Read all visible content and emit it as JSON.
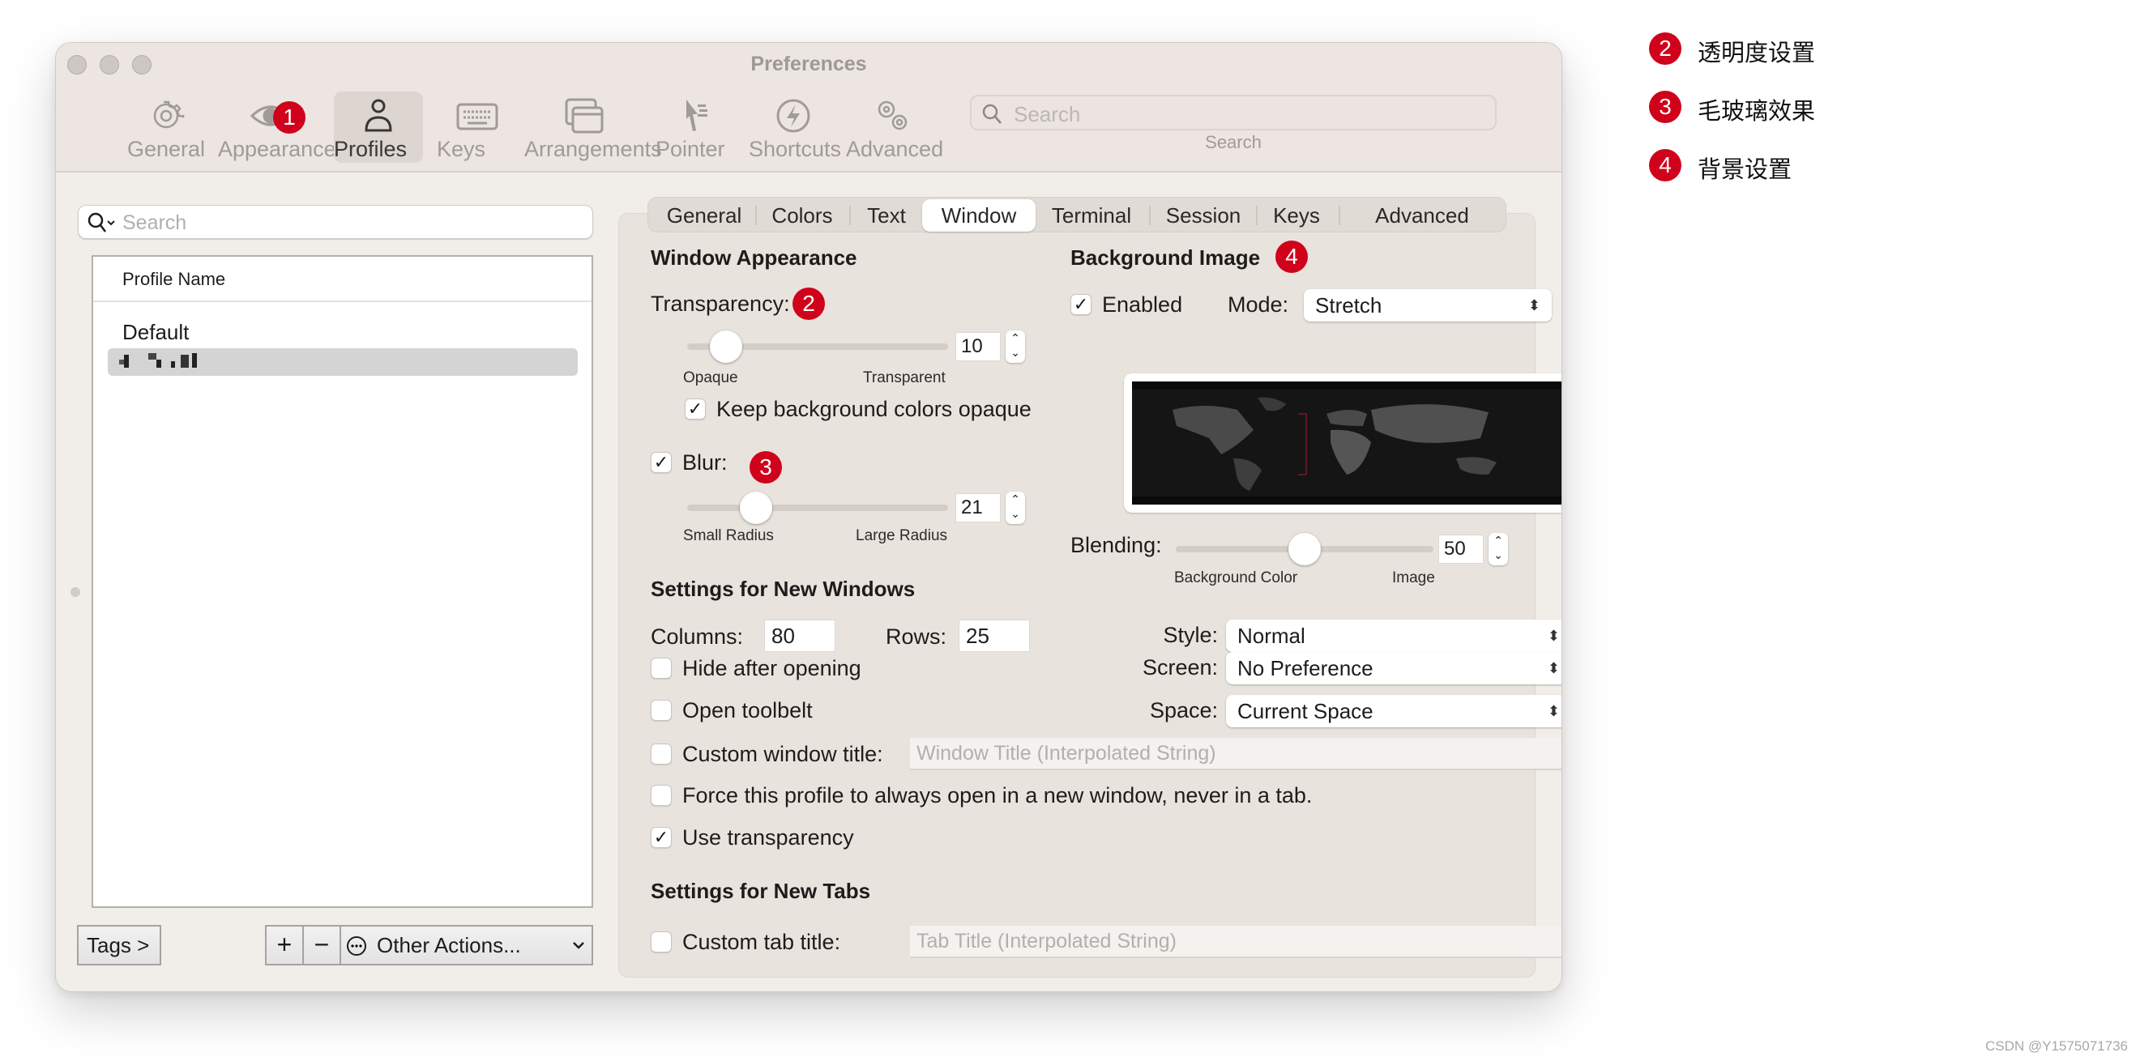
{
  "window": {
    "title": "Preferences"
  },
  "toolbar": {
    "items": [
      {
        "label": "General",
        "icon": "gear-icon"
      },
      {
        "label": "Appearance",
        "icon": "eye-icon"
      },
      {
        "label": "Profiles",
        "icon": "person-icon",
        "active": true
      },
      {
        "label": "Keys",
        "icon": "keyboard-icon"
      },
      {
        "label": "Arrangements",
        "icon": "windows-icon"
      },
      {
        "label": "Pointer",
        "icon": "pointer-icon"
      },
      {
        "label": "Shortcuts",
        "icon": "bolt-icon"
      },
      {
        "label": "Advanced",
        "icon": "gears-icon"
      }
    ],
    "search_placeholder": "Search",
    "search_label": "Search"
  },
  "badges": {
    "b1": "1",
    "b2": "2",
    "b3": "3",
    "b4": "4",
    "color": "#d0021b"
  },
  "profiles": {
    "search_placeholder": "Search",
    "column_header": "Profile Name",
    "rows": [
      {
        "name": "Default"
      },
      {
        "name": "(redacted)",
        "selected": true
      }
    ],
    "tags_button": "Tags >",
    "add_button": "+",
    "remove_button": "−",
    "other_actions": "Other Actions..."
  },
  "tabs": {
    "items": [
      "General",
      "Colors",
      "Text",
      "Window",
      "Terminal",
      "Session",
      "Keys",
      "Advanced"
    ],
    "active": "Window"
  },
  "window_appearance": {
    "heading": "Window Appearance",
    "transparency_label": "Transparency:",
    "transparency_value": "10",
    "transparency_fraction": 0.1,
    "transparency_min_label": "Opaque",
    "transparency_max_label": "Transparent",
    "keep_bg_opaque_label": "Keep background colors opaque",
    "keep_bg_opaque": true,
    "blur_label": "Blur:",
    "blur_enabled": true,
    "blur_value": "21",
    "blur_fraction": 0.23,
    "blur_min_label": "Small Radius",
    "blur_max_label": "Large Radius"
  },
  "background_image": {
    "heading": "Background Image",
    "enabled_label": "Enabled",
    "enabled": true,
    "mode_label": "Mode:",
    "mode_value": "Stretch",
    "blending_label": "Blending:",
    "blending_value": "50",
    "blending_fraction": 0.5,
    "blending_min_label": "Background Color",
    "blending_max_label": "Image"
  },
  "new_windows": {
    "heading": "Settings for New Windows",
    "columns_label": "Columns:",
    "columns_value": "80",
    "rows_label": "Rows:",
    "rows_value": "25",
    "style_label": "Style:",
    "style_value": "Normal",
    "screen_label": "Screen:",
    "screen_value": "No Preference",
    "space_label": "Space:",
    "space_value": "Current Space",
    "hide_after_opening": "Hide after opening",
    "open_toolbelt": "Open toolbelt",
    "custom_window_title": "Custom window title:",
    "window_title_placeholder": "Window Title (Interpolated String)",
    "force_new_window": "Force this profile to always open in a new window, never in a tab.",
    "use_transparency": "Use transparency",
    "use_transparency_checked": true
  },
  "new_tabs": {
    "heading": "Settings for New Tabs",
    "custom_tab_title": "Custom tab title:",
    "tab_title_placeholder": "Tab Title (Interpolated String)"
  },
  "legend": [
    {
      "num": "2",
      "text": "透明度设置"
    },
    {
      "num": "3",
      "text": "毛玻璃效果"
    },
    {
      "num": "4",
      "text": "背景设置"
    }
  ],
  "watermark": "CSDN @Y1575071736"
}
